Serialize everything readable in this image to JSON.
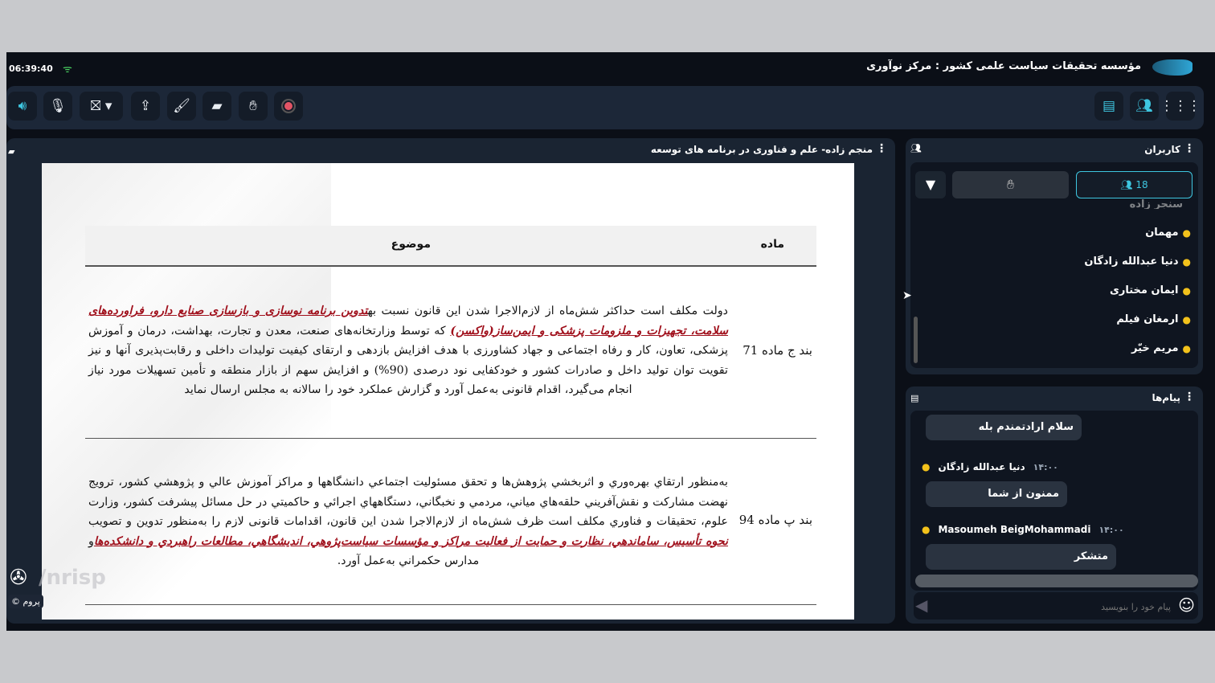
{
  "header": {
    "clock": "06:39:40",
    "title": "مؤسسه تحقیقات سیاست علمی کشور : مرکز نوآوری",
    "logo_text": "nrisp"
  },
  "toolbar": {
    "icons": [
      "speaker-icon",
      "mic-off-icon",
      "camera-off-icon",
      "share-screen-icon",
      "brush-icon",
      "folder-icon",
      "raise-hand-icon",
      "record-icon"
    ],
    "right_icons": [
      "chat-icon",
      "users-icon",
      "apps-grid-icon"
    ],
    "accent": "#3ec6e0"
  },
  "document_panel": {
    "title": "منجم زاده- علم و فناوری در برنامه های توسعه",
    "table": {
      "headers": {
        "article": "ماده",
        "subject": "موضوع"
      },
      "rows": [
        {
          "article": "بند ج ماده 71",
          "before": "دولت مکلف است حداکثر شش‌ماه از لازم‌الاجرا شدن این قانون نسبت به",
          "highlight": "تدوین برنامه نوسازی و بازسازی صنایع دارو، فراورده‌های سلامت، تجهیزات و ملزومات پزشکی و ایمن‌ساز(واکسن)",
          "after": " که توسط وزارتخانه‌های صنعت، معدن و تجارت، بهداشت، درمان و آموزش پزشکی، تعاون، کار و رفاه اجتماعی و جهاد کشاورزی با هدف افزایش بازدهی و ارتقای کیفیت تولیدات داخلی و رقابت‌پذیری آنها و نیز تقویت توان تولید داخل و صادرات کشور و خودکفایی نود درصدی (90%) و افزایش سهم از بازار منطقه و تأمین تسهیلات مورد نیاز انجام می‌گیرد، اقدام قانونی به‌عمل آورد و گزارش عملکرد خود را سالانه به مجلس ارسال نماید"
        },
        {
          "article": "بند پ ماده 94",
          "before": "به‌منظور ارتقاي بهره‌وري و اثربخشي پژوهش‌ها و تحقق مسئوليت اجتماعي دانشگاهها و مراكز آموزش عالي و پژوهشي كشور، ترويج نهضت مشاركت و نقش‌آفريني حلقه‌هاي مياني، مردمي و نخبگاني، دستگاههاي اجرائي و حاكميتي در حل مسائل پيشرفت كشور، وزارت علوم، تحقيقات و فناوري مكلف است ظرف شش‌ماه از لازم‌الاجرا شدن اين قانون، اقدامات قانونی لازم را به‌منظور تدوين و تصويب ",
          "highlight": "نحوه تأسيس، ساماندهي، نظارت و حمايت از فعاليت مراكز و مؤسسات سياست‌پژوهي، انديشگاهي، مطالعات راهبردي و دانشكده‌ها",
          "after": "و مدارس حكمراني به‌عمل آورد."
        }
      ]
    }
  },
  "watermark": {
    "text": "/nrisp",
    "badge": "© پروم"
  },
  "users_panel": {
    "title": "کاربران",
    "count": "18",
    "users": [
      "سنجر زاده",
      "مهمان",
      "دنیا عبدالله زادگان",
      "ایمان مختاری",
      "ارمغان فیلم",
      "مریم خیّر"
    ]
  },
  "messages_panel": {
    "title": "پیام‌ها",
    "messages": [
      {
        "sender": "",
        "time": "",
        "text": "سلام ارادتمندم بله"
      },
      {
        "sender": "دنیا عبدالله زادگان",
        "time": "۱۴:۰۰",
        "text": "ممنون از شما"
      },
      {
        "sender": "Masoumeh BeigMohammadi",
        "time": "۱۴:۰۰",
        "text": "متشکر"
      }
    ],
    "input_placeholder": "پیام خود را بنویسید"
  }
}
